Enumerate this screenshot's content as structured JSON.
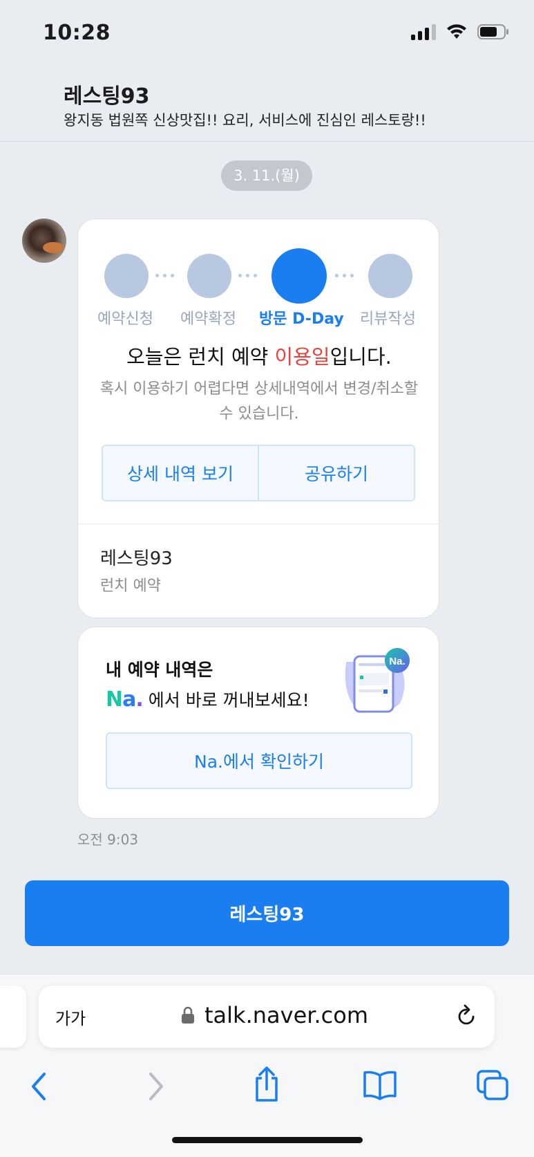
{
  "status_bar": {
    "time": "10:28"
  },
  "header": {
    "title": "레스팅93",
    "description": "왕지동 법원쪽 신상맛집!! 요리, 서비스에 진심인 레스토랑!!"
  },
  "date_pill": "3. 11.(월)",
  "reservation_card": {
    "steps": [
      {
        "label": "예약신청",
        "active": false
      },
      {
        "label": "예약확정",
        "active": false
      },
      {
        "label": "방문 D-Day",
        "active": true
      },
      {
        "label": "리뷰작성",
        "active": false
      }
    ],
    "title_prefix": "오늘은 런치 예약 ",
    "title_highlight": "이용일",
    "title_suffix": "입니다.",
    "subtitle": "혹시 이용하기 어렵다면 상세내역에서 변경/취소할 수 있습니다.",
    "detail_button": "상세 내역 보기",
    "share_button": "공유하기",
    "store_name": "레스팅93",
    "store_sub": "런치 예약"
  },
  "promo_card": {
    "line1": "내 예약 내역은",
    "logo_n": "N",
    "logo_a": "a",
    "logo_dot": ".",
    "line2": "에서 바로 꺼내보세요!",
    "badge": "Na.",
    "button": "Na.에서 확인하기"
  },
  "message_time": "오전 9:03",
  "main_button": "레스팅93",
  "browser": {
    "text_size_label": "가가",
    "url": "talk.naver.com"
  },
  "colors": {
    "accent": "#1a7ef0",
    "highlight": "#e9413a",
    "step_inactive": "#b7c8e0",
    "background": "#e9ecf1"
  }
}
